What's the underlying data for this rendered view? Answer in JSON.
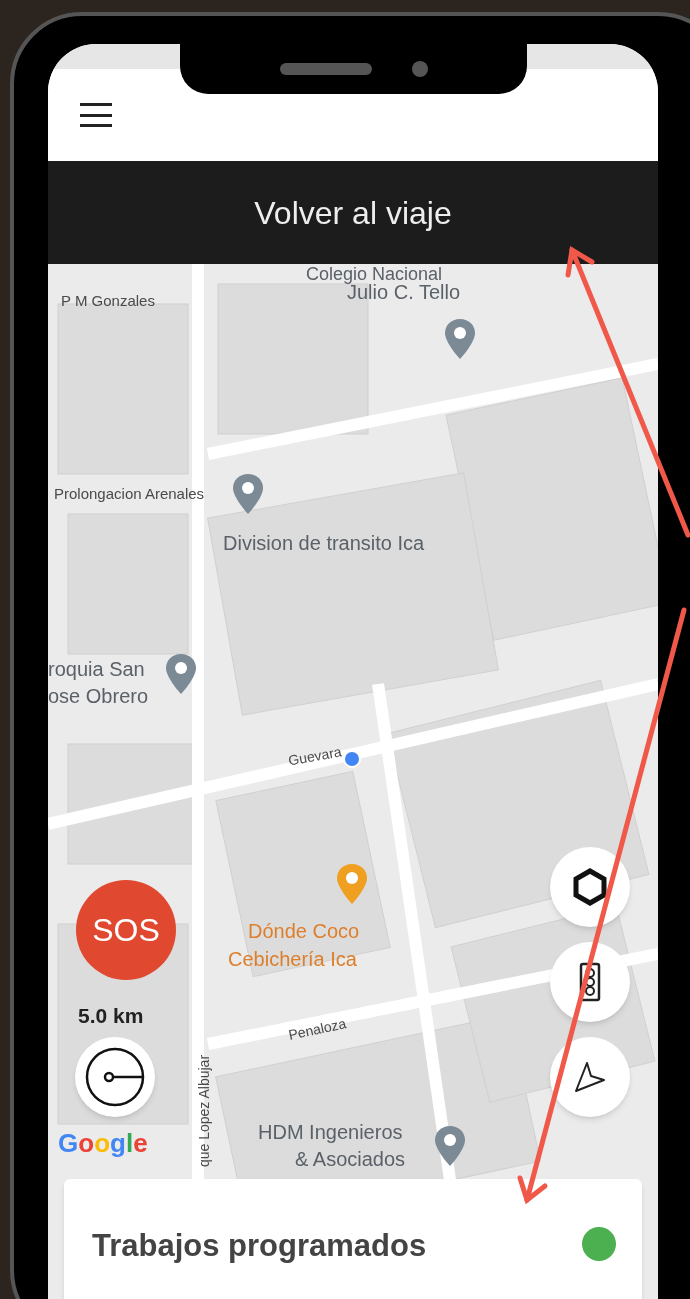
{
  "back_bar": {
    "label": "Volver al viaje"
  },
  "map": {
    "labels": [
      {
        "text": "Colegio Nacional",
        "kind": "place"
      },
      {
        "text": "Julio C. Tello",
        "kind": "place"
      },
      {
        "text": "P M Gonzales",
        "kind": "street"
      },
      {
        "text": "Prolongacion Arenales",
        "kind": "street"
      },
      {
        "text": "Division de transito Ica",
        "kind": "place"
      },
      {
        "text": "roquia San",
        "kind": "place"
      },
      {
        "text": "ose Obrero",
        "kind": "place"
      },
      {
        "text": "Guevara",
        "kind": "street"
      },
      {
        "text": "Dónde Coco",
        "kind": "food"
      },
      {
        "text": "Cebichería Ica",
        "kind": "food"
      },
      {
        "text": "Penaloza",
        "kind": "street"
      },
      {
        "text": "que Lopez Albujar",
        "kind": "street"
      },
      {
        "text": "HDM Ingenieros",
        "kind": "place"
      },
      {
        "text": "& Asociados",
        "kind": "place"
      }
    ],
    "sos": "SOS",
    "distance": "5.0 km",
    "attribution": "Google"
  },
  "card": {
    "title": "Trabajos programados",
    "color": "#4caf50"
  }
}
